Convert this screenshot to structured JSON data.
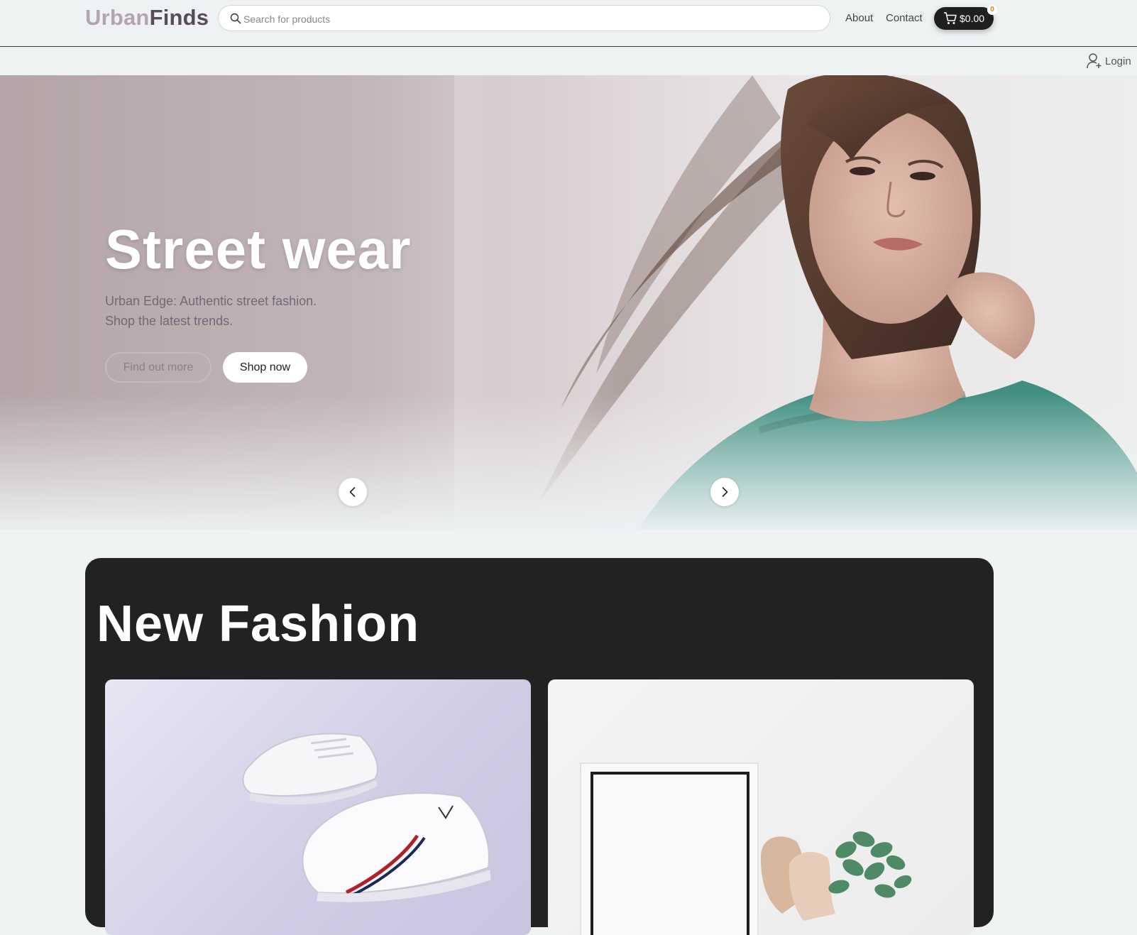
{
  "header": {
    "logo": {
      "part1": "Urban",
      "part2": "Finds"
    },
    "search": {
      "placeholder": "Search for products"
    },
    "nav": {
      "about": "About",
      "contact": "Contact"
    },
    "cart": {
      "amount": "$0.00",
      "count": "0"
    }
  },
  "subbar": {
    "login": "Login"
  },
  "hero": {
    "title": "Street wear",
    "subtitle_line1": "Urban Edge: Authentic street fashion.",
    "subtitle_line2": "Shop the latest trends.",
    "find_out_more": "Find out more",
    "shop_now": "Shop now"
  },
  "new_fashion": {
    "title": "New Fashion"
  },
  "icons": {
    "search": "search-icon",
    "cart": "cart-icon",
    "user": "user-add-icon",
    "prev": "chevron-left-icon",
    "next": "chevron-right-icon"
  },
  "colors": {
    "logo_light": "#b5a3b1",
    "logo_dark": "#5a4a5c",
    "panel_bg": "#222222",
    "cart_bg": "#1f1f1f",
    "badge_text": "#e07b1a",
    "page_bg": "#eef2f3"
  }
}
